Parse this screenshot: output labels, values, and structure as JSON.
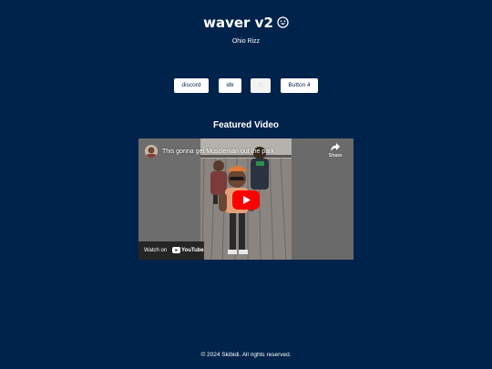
{
  "header": {
    "title": "waver v2",
    "title_icon": "smiley-icon",
    "subtitle": "Ohio Rizz"
  },
  "buttons": [
    {
      "label": "discord"
    },
    {
      "label": "idk"
    },
    {
      "label": "□"
    },
    {
      "label": "Button 4"
    }
  ],
  "featured": {
    "heading": "Featured Video"
  },
  "video": {
    "title": "This gonna get Muscleman out the park",
    "share_label": "Share",
    "watch_on_label": "Watch on",
    "brand": "YouTube",
    "accent_color": "#ff0000"
  },
  "footer": {
    "text": "© 2024 Skibidi. All rights reserved."
  },
  "colors": {
    "background": "#00234b",
    "text": "#ffffff",
    "button_bg": "#ffffff",
    "button_text": "#00234b"
  }
}
